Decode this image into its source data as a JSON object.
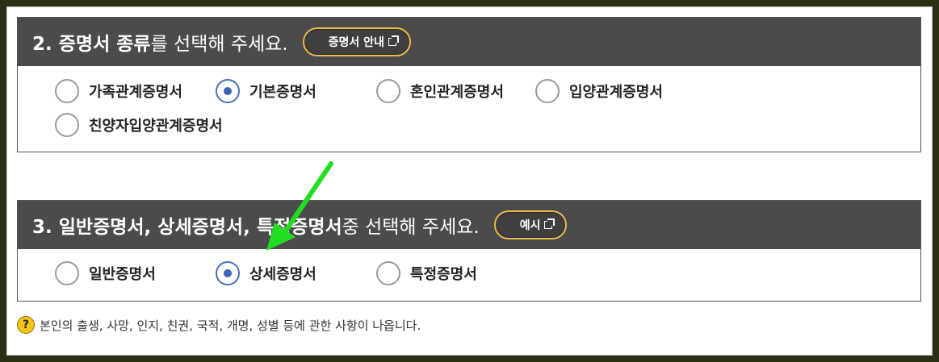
{
  "section2": {
    "title_bold": "2. 증명서 종류",
    "title_normal": "를 선택해 주세요.",
    "guide_button": "증명서 안내",
    "options": [
      {
        "label": "가족관계증명서",
        "checked": false
      },
      {
        "label": "기본증명서",
        "checked": true
      },
      {
        "label": "혼인관계증명서",
        "checked": false
      },
      {
        "label": "입양관계증명서",
        "checked": false
      },
      {
        "label": "친양자입양관계증명서",
        "checked": false
      }
    ]
  },
  "section3": {
    "title_bold": "3. 일반증명서, 상세증명서, 특정증명서",
    "title_normal": " 중 선택해 주세요.",
    "example_button": "예시",
    "options": [
      {
        "label": "일반증명서",
        "checked": false
      },
      {
        "label": "상세증명서",
        "checked": true
      },
      {
        "label": "특정증명서",
        "checked": false
      }
    ]
  },
  "note": {
    "icon": "question-icon",
    "text": "본인의 출생, 사망, 인지, 친권, 국적, 개명, 성별 등에 관한 사항이 나옵니다."
  },
  "colors": {
    "header_bg": "#4b4b4b",
    "pill_border": "#e8c04a",
    "radio_checked": "#3a63b5",
    "annotation_arrow": "#22dd22"
  }
}
